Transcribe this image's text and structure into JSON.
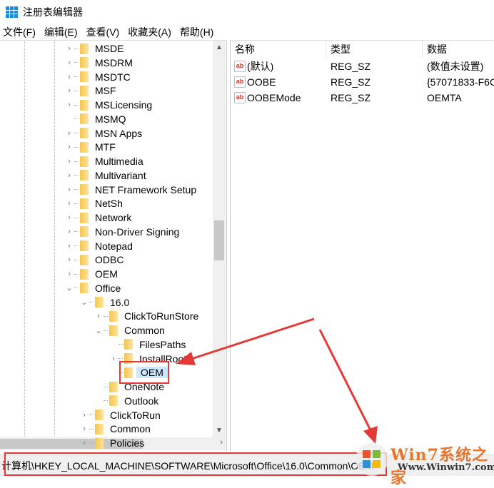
{
  "window": {
    "title": "注册表编辑器"
  },
  "menu": [
    "文件(F)",
    "编辑(E)",
    "查看(V)",
    "收藏夹(A)",
    "帮助(H)"
  ],
  "tree": [
    {
      "label": "MSDE",
      "level": 0,
      "arrow": "›"
    },
    {
      "label": "MSDRM",
      "level": 0,
      "arrow": "›"
    },
    {
      "label": "MSDTC",
      "level": 0,
      "arrow": "›"
    },
    {
      "label": "MSF",
      "level": 0,
      "arrow": "›"
    },
    {
      "label": "MSLicensing",
      "level": 0,
      "arrow": "›"
    },
    {
      "label": "MSMQ",
      "level": 0,
      "arrow": ""
    },
    {
      "label": "MSN Apps",
      "level": 0,
      "arrow": "›"
    },
    {
      "label": "MTF",
      "level": 0,
      "arrow": "›"
    },
    {
      "label": "Multimedia",
      "level": 0,
      "arrow": "›"
    },
    {
      "label": "Multivariant",
      "level": 0,
      "arrow": "›"
    },
    {
      "label": "NET Framework Setup",
      "level": 0,
      "arrow": "›"
    },
    {
      "label": "NetSh",
      "level": 0,
      "arrow": "›"
    },
    {
      "label": "Network",
      "level": 0,
      "arrow": "›"
    },
    {
      "label": "Non-Driver Signing",
      "level": 0,
      "arrow": "›"
    },
    {
      "label": "Notepad",
      "level": 0,
      "arrow": "›"
    },
    {
      "label": "ODBC",
      "level": 0,
      "arrow": "›"
    },
    {
      "label": "OEM",
      "level": 0,
      "arrow": "›"
    },
    {
      "label": "Office",
      "level": 0,
      "arrow": "⌄"
    },
    {
      "label": "16.0",
      "level": 1,
      "arrow": "⌄"
    },
    {
      "label": "ClickToRunStore",
      "level": 2,
      "arrow": "›"
    },
    {
      "label": "Common",
      "level": 2,
      "arrow": "⌄"
    },
    {
      "label": "FilesPaths",
      "level": 3,
      "arrow": ""
    },
    {
      "label": "InstallRoot",
      "level": 3,
      "arrow": "›"
    },
    {
      "label": "OEM",
      "level": 3,
      "arrow": "",
      "selected": true
    },
    {
      "label": "OneNote",
      "level": 2,
      "arrow": ""
    },
    {
      "label": "Outlook",
      "level": 2,
      "arrow": ""
    },
    {
      "label": "ClickToRun",
      "level": 1,
      "arrow": "›"
    },
    {
      "label": "Common",
      "level": 1,
      "arrow": "›"
    },
    {
      "label": "Policies",
      "level": 1,
      "arrow": "›"
    }
  ],
  "columns": [
    "名称",
    "类型",
    "数据"
  ],
  "values": [
    {
      "name": "(默认)",
      "type": "REG_SZ",
      "data": "(数值未设置)"
    },
    {
      "name": "OOBE",
      "type": "REG_SZ",
      "data": "{57071833-F6C"
    },
    {
      "name": "OOBEMode",
      "type": "REG_SZ",
      "data": "OEMTA"
    }
  ],
  "status": {
    "path": "计算机\\HKEY_LOCAL_MACHINE\\SOFTWARE\\Microsoft\\Office\\16.0\\Common\\OEM"
  },
  "watermark": {
    "title": "Win7系统之家",
    "url": "Www.Winwin7.com"
  },
  "colors": {
    "highlight": "#e53935",
    "selection": "#cce8ff"
  }
}
